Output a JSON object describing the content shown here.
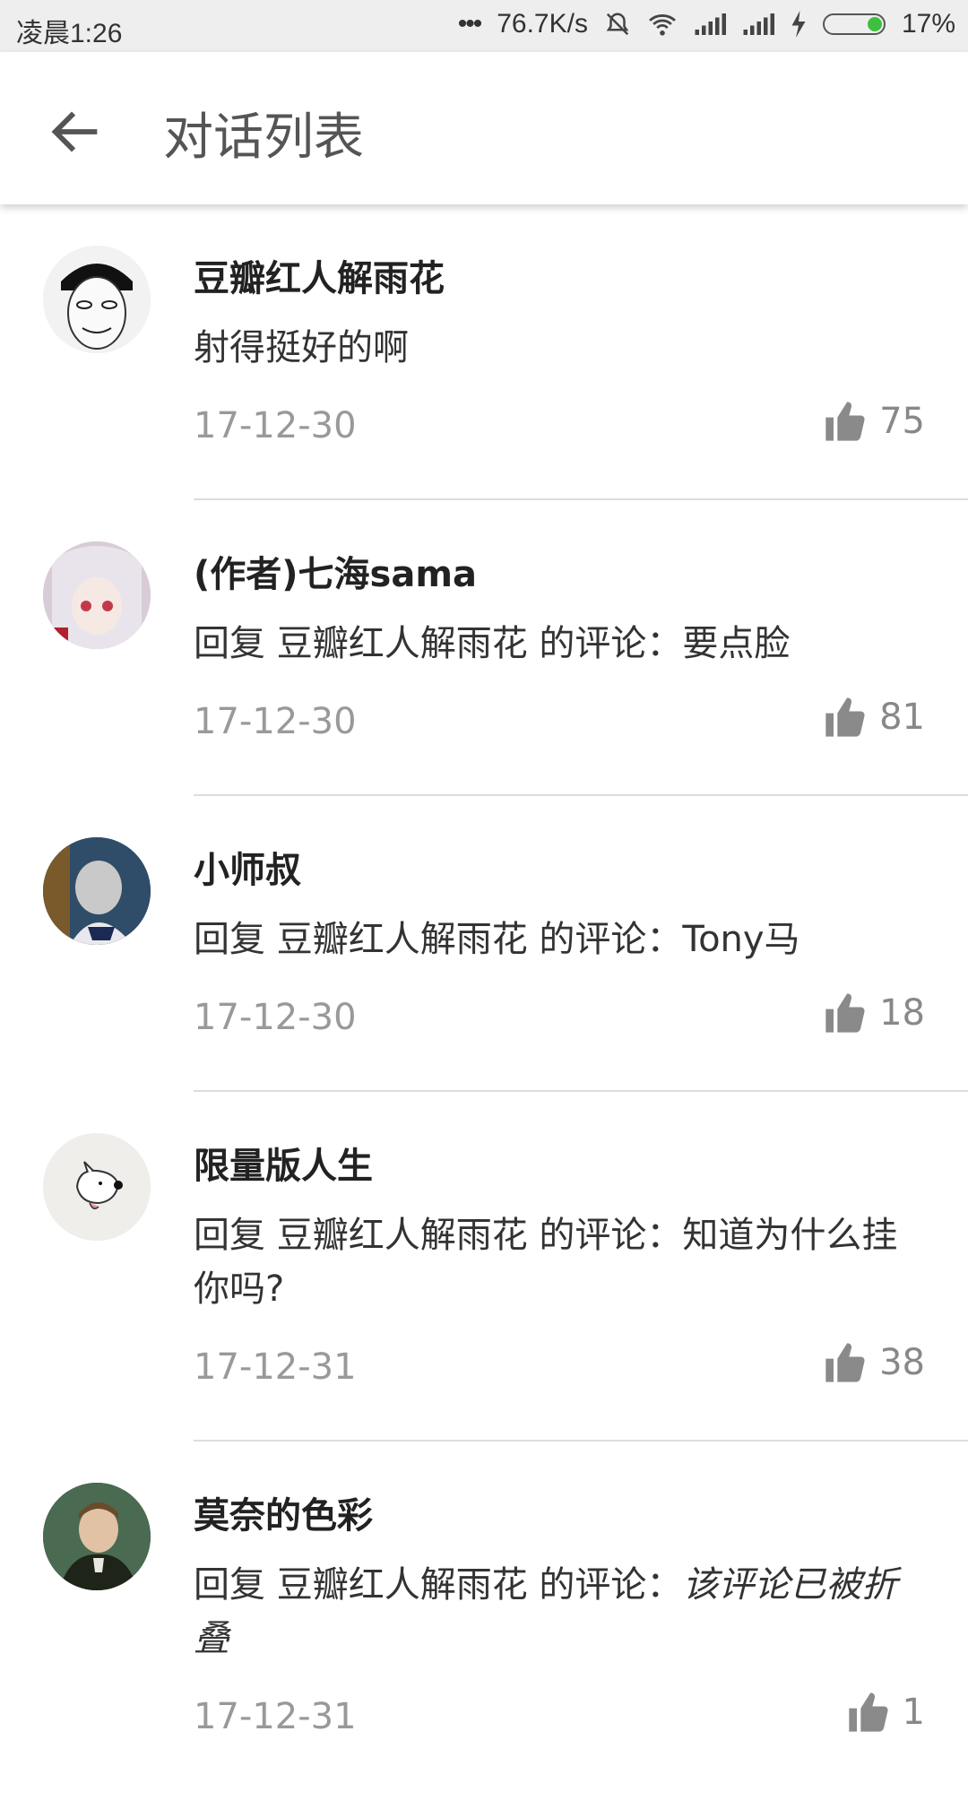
{
  "status_bar": {
    "time": "凌晨1:26",
    "network_speed": "76.7K/s",
    "battery": "17%",
    "icons": [
      "more-dots-icon",
      "mute-bell-icon",
      "wifi-icon",
      "signal-icon",
      "signal-icon",
      "charging-icon",
      "battery-icon"
    ]
  },
  "header": {
    "back_icon": "arrow-left-icon",
    "title": "对话列表"
  },
  "conversations": [
    {
      "name": "豆瓣红人解雨花",
      "comment": "射得挺好的啊",
      "folded_text": "",
      "date": "17-12-30",
      "likes": "75",
      "avatar_color": "#e8e8e8"
    },
    {
      "name": "(作者)七海sama",
      "comment": "回复 豆瓣红人解雨花 的评论：要点脸",
      "folded_text": "",
      "date": "17-12-30",
      "likes": "81",
      "avatar_color": "#c9b8c8"
    },
    {
      "name": "小师叔",
      "comment": "回复 豆瓣红人解雨花 的评论：Tony马",
      "folded_text": "",
      "date": "17-12-30",
      "likes": "18",
      "avatar_color": "#3a5a78"
    },
    {
      "name": "限量版人生",
      "comment": "回复 豆瓣红人解雨花 的评论：知道为什么挂你吗?",
      "folded_text": "",
      "date": "17-12-31",
      "likes": "38",
      "avatar_color": "#ededea"
    },
    {
      "name": "莫奈的色彩",
      "comment": "回复 豆瓣红人解雨花 的评论：",
      "folded_text": "该评论已被折叠",
      "date": "17-12-31",
      "likes": "1",
      "avatar_color": "#3b4a2e"
    }
  ],
  "colors": {
    "title": "#555555",
    "name": "#222222",
    "meta": "#999999",
    "divider": "#dddddd"
  }
}
